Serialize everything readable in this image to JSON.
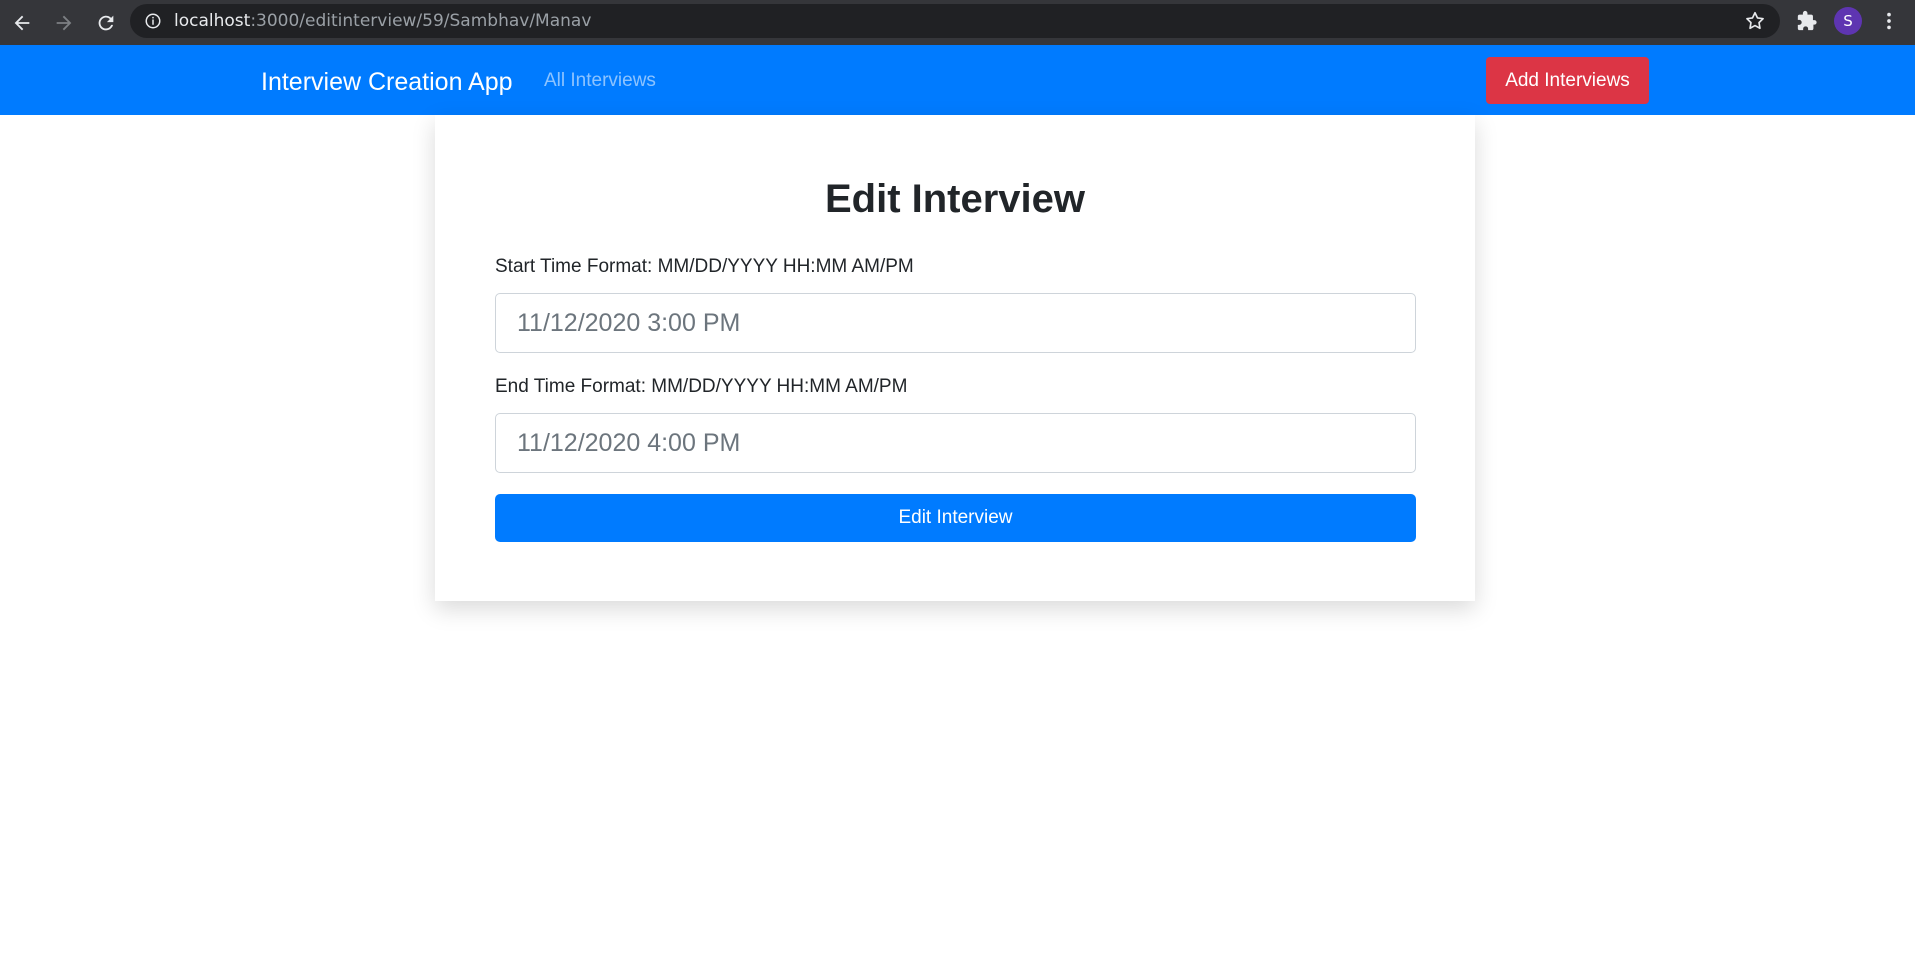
{
  "browser": {
    "url_host": "localhost",
    "url_path": ":3000/editinterview/59/Sambhav/Manav",
    "profile_initial": "S",
    "icons": [
      "back-arrow-icon",
      "forward-arrow-icon",
      "reload-icon",
      "info-icon",
      "star-icon",
      "extensions-icon",
      "kebab-menu-icon"
    ]
  },
  "navbar": {
    "brand": "Interview Creation App",
    "link_all": "All Interviews",
    "add_button": "Add Interviews",
    "colors": {
      "navbar_bg": "#007bff",
      "add_button_bg": "#dc3545"
    }
  },
  "form": {
    "title": "Edit Interview",
    "start_label": "Start Time Format: MM/DD/YYYY HH:MM AM/PM",
    "start_placeholder": "11/12/2020 3:00 PM",
    "end_label": "End Time Format: MM/DD/YYYY HH:MM AM/PM",
    "end_placeholder": "11/12/2020 4:00 PM",
    "submit_label": "Edit Interview",
    "colors": {
      "submit_bg": "#007bff"
    }
  }
}
